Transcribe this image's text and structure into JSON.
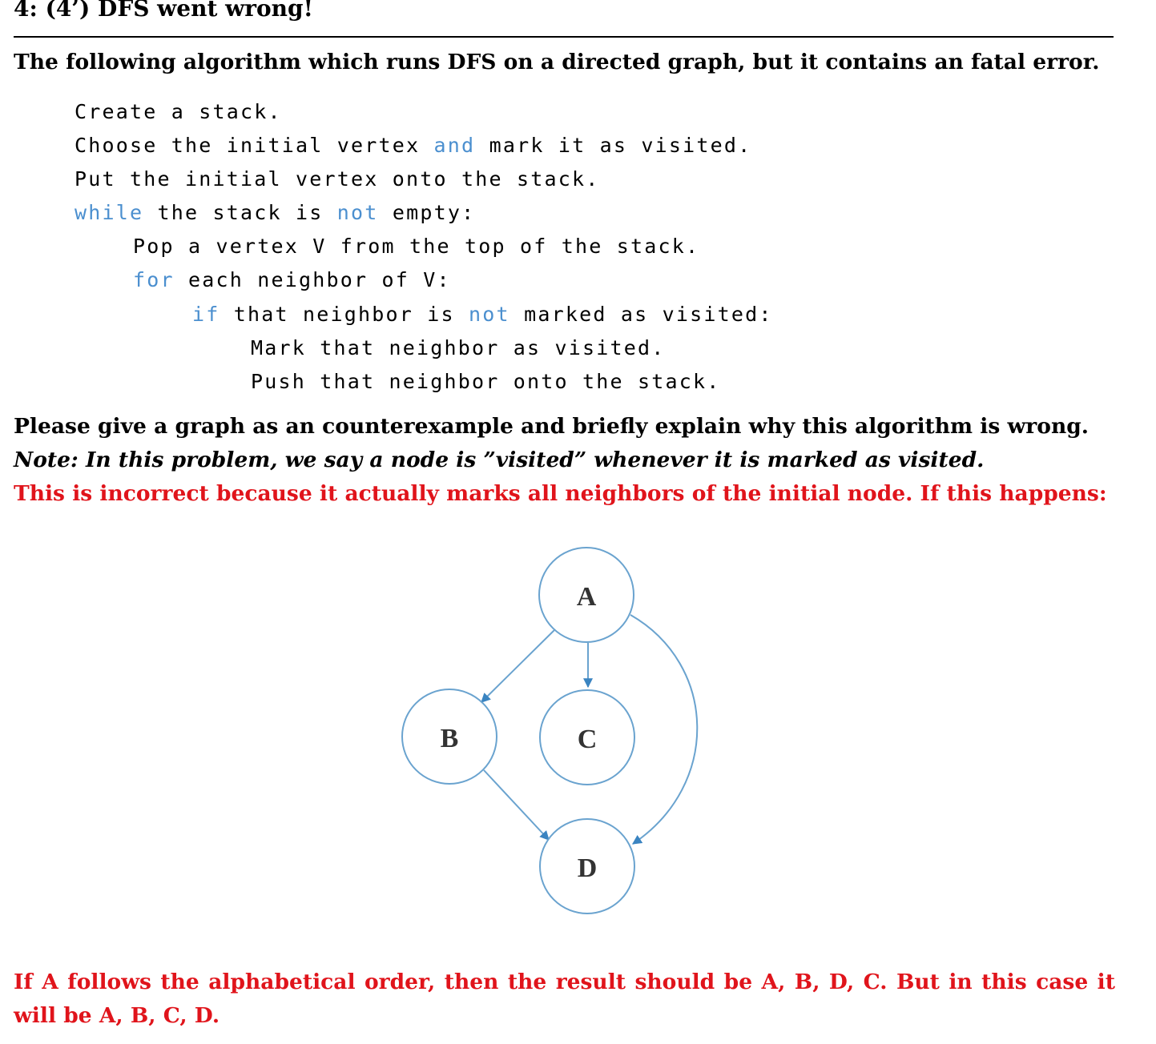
{
  "problem": {
    "heading": "4: (4’) DFS went wrong!",
    "intro": "The following algorithm which runs DFS on a directed graph, but it contains an fatal error.",
    "ask": "Please give a graph as an counterexample and briefly explain why this algorithm is wrong.",
    "note": "Note: In this problem, we say a node is ”visited” whenever it is marked as visited."
  },
  "algorithm": {
    "lines": [
      {
        "indent": 0,
        "parts": [
          {
            "text": "Create a stack.",
            "kw": false
          }
        ]
      },
      {
        "indent": 0,
        "parts": [
          {
            "text": "Choose the initial vertex ",
            "kw": false
          },
          {
            "text": "and",
            "kw": true
          },
          {
            "text": " mark it as visited.",
            "kw": false
          }
        ]
      },
      {
        "indent": 0,
        "parts": [
          {
            "text": "Put the initial vertex onto the stack.",
            "kw": false
          }
        ]
      },
      {
        "indent": 0,
        "parts": [
          {
            "text": "while",
            "kw": true
          },
          {
            "text": " the stack is ",
            "kw": false
          },
          {
            "text": "not",
            "kw": true
          },
          {
            "text": " empty:",
            "kw": false
          }
        ]
      },
      {
        "indent": 1,
        "parts": [
          {
            "text": "Pop a vertex V from the top of the stack.",
            "kw": false
          }
        ]
      },
      {
        "indent": 1,
        "parts": [
          {
            "text": "for",
            "kw": true
          },
          {
            "text": " each neighbor of V:",
            "kw": false
          }
        ]
      },
      {
        "indent": 2,
        "parts": [
          {
            "text": "if",
            "kw": true
          },
          {
            "text": " that neighbor is ",
            "kw": false
          },
          {
            "text": "not",
            "kw": true
          },
          {
            "text": " marked as visited:",
            "kw": false
          }
        ]
      },
      {
        "indent": 3,
        "parts": [
          {
            "text": "Mark that neighbor as visited.",
            "kw": false
          }
        ]
      },
      {
        "indent": 3,
        "parts": [
          {
            "text": "Push that neighbor onto the stack.",
            "kw": false
          }
        ]
      }
    ]
  },
  "answer": {
    "incorrect": "This is incorrect because it actually marks all neighbors of the initial node. If this happens:",
    "conclusion": "If A follows the alphabetical order, then the result should be A, B, D, C. But in this case it will be A, B, C, D."
  },
  "graph": {
    "nodes": [
      "A",
      "B",
      "C",
      "D"
    ],
    "edges": [
      [
        "A",
        "B"
      ],
      [
        "A",
        "C"
      ],
      [
        "A",
        "D"
      ],
      [
        "B",
        "D"
      ]
    ],
    "colors": {
      "circle": "#6aa3cf",
      "arrow": "#3a84c1",
      "label": "#333333",
      "keyword": "#4b8fcf",
      "answer_text": "#e0141b"
    }
  }
}
